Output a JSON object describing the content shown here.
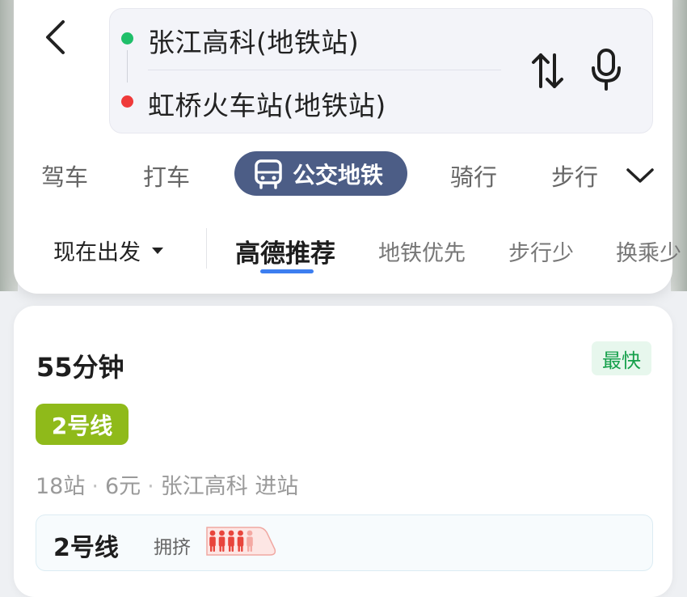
{
  "header": {
    "from": "张江高科(地铁站)",
    "to": "虹桥火车站(地铁站)"
  },
  "icons": {
    "back": "back-arrow-icon",
    "swap": "swap-arrows-icon",
    "mic": "microphone-icon",
    "bus": "bus-icon",
    "expand": "chevron-down-icon",
    "crowd": "crowd-level-icon"
  },
  "modes": {
    "items": [
      "驾车",
      "打车",
      "公交地铁",
      "骑行",
      "步行"
    ],
    "active": "公交地铁"
  },
  "filters": {
    "depart": "现在出发",
    "sort_options": [
      "高德推荐",
      "地铁优先",
      "步行少",
      "换乘少"
    ],
    "active": "高德推荐"
  },
  "result": {
    "duration": "55分钟",
    "badge": "最快",
    "line": "2号线",
    "stops": "18站",
    "fare": "6元",
    "board": "张江高科 进站",
    "segment_line": "2号线",
    "crowd_text": "拥挤",
    "crowd_level": "4 of 5"
  },
  "colors": {
    "accent_blue": "#3d7ef0",
    "mode_active_bg": "#4c5d86",
    "line2_green": "#8fba1a",
    "fast_green": "#15a04b",
    "origin_dot": "#1fbf6a",
    "dest_dot": "#ef3a3a",
    "crowd_red": "#e8453c"
  }
}
